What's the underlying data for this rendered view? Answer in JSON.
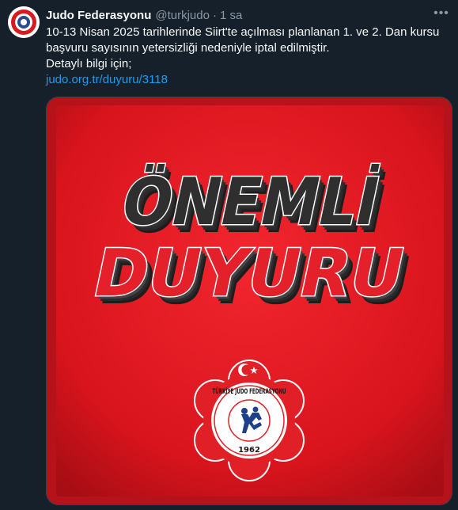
{
  "author": {
    "name": "Judo Federasyonu",
    "handle": "@turkjudo",
    "separator": "·",
    "time": "1 sa"
  },
  "more_icon": "more-horizontal-icon",
  "tweet": {
    "line1": "10-13 Nisan 2025 tarihlerinde Siirt'te açılması planlanan 1. ve 2. Dan kursu",
    "line2": "başvuru sayısının yetersizliği nedeniyle iptal edilmiştir.",
    "line3": "Detaylı bilgi için;",
    "link": "judo.org.tr/duyuru/3118"
  },
  "image": {
    "headline1": "ÖNEMLİ",
    "headline2": "DUYURU",
    "seal_top": "TÜRKİYE JUDO FEDERASYONU",
    "seal_year": "1962"
  },
  "colors": {
    "background": "#15202b",
    "link": "#1d9bf0",
    "poster_red": "#e4202a"
  }
}
